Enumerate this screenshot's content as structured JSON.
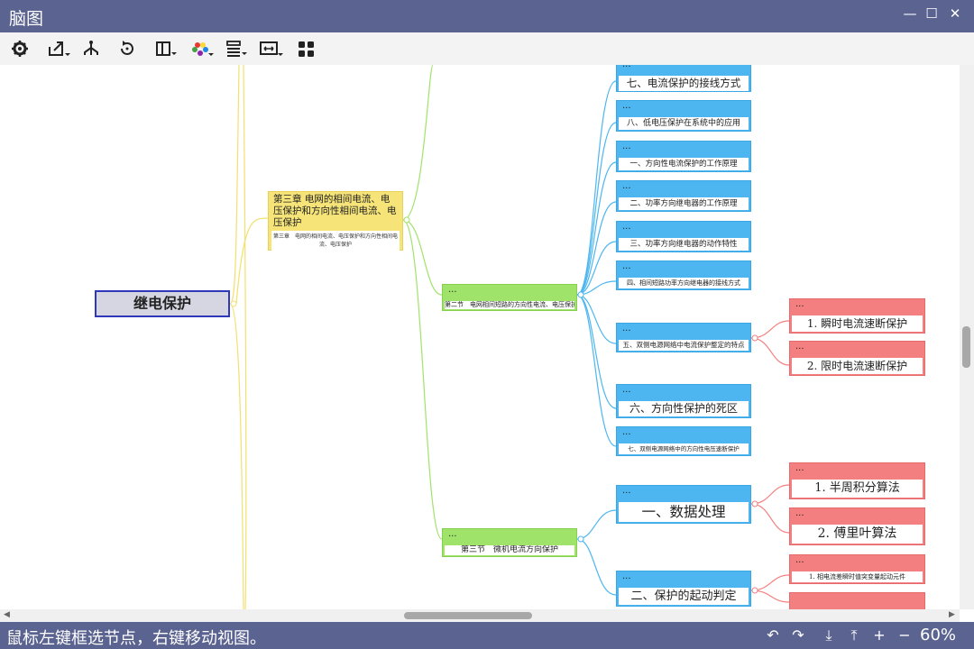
{
  "app": {
    "title": "脑图"
  },
  "window_controls": {
    "minimize": "—",
    "maximize": "☐",
    "close": "✕"
  },
  "toolbar": [
    "gear-icon",
    "export-icon",
    "share-icon",
    "refresh-icon",
    "layout-icon",
    "palette-icon",
    "align-icon",
    "fit-width-icon",
    "grid-icon"
  ],
  "mindmap": {
    "root": "继电保护",
    "chapter": {
      "title": "第三章 电网的相间电流、电压保护和方向性相间电流、电压保护",
      "subtitle": "第三章　电网的相间电流、电压保护和方向性相间电流、电压保护"
    },
    "ellipsis": "...",
    "sections": [
      {
        "label": "第二节　电网相间短路的方向性电流、电压保护"
      },
      {
        "label": "第三节　微机电流方向保护"
      }
    ],
    "items": [
      "七、电流保护的接线方式",
      "八、低电压保护在系统中的应用",
      "一、方向性电流保护的工作原理",
      "二、功率方向继电器的工作原理",
      "三、功率方向继电器的动作特性",
      "四、相间短路功率方向继电器的接线方式",
      "五、双侧电源网络中电流保护整定的特点",
      "六、方向性保护的死区",
      "七、双侧电源网络中的方向性电压速断保护",
      "一、数据处理",
      "二、保护的起动判定"
    ],
    "subitems": [
      "1. 瞬时电流速断保护",
      "2. 限时电流速断保护",
      "1. 半周积分算法",
      "2. 傅里叶算法",
      "1. 相电流差瞬时值突变量起动元件"
    ]
  },
  "status": {
    "message": "鼠标左键框选节点，右键移动视图。",
    "zoom": "60%"
  },
  "colors": {
    "titlebar": "#5b6390",
    "section": "#a0e36b",
    "item": "#4db6f0",
    "subitem": "#f47f80",
    "chapter": "#f6e479"
  }
}
